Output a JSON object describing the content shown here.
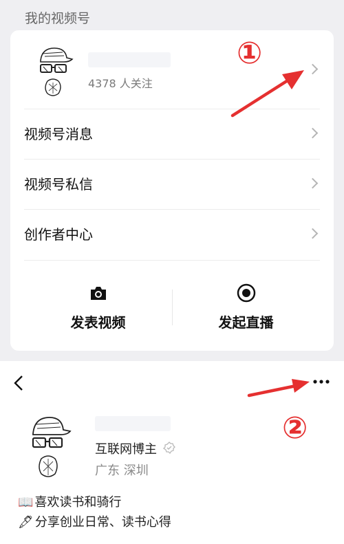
{
  "section": {
    "title": "我的视频号"
  },
  "profile": {
    "followers": "4378 人关注"
  },
  "menu": [
    {
      "label": "视频号消息"
    },
    {
      "label": "视频号私信"
    },
    {
      "label": "创作者中心"
    }
  ],
  "actions": {
    "post_video": "发表视频",
    "start_live": "发起直播"
  },
  "annotations": {
    "marker1": "①",
    "marker2": "②",
    "color": "#e53030"
  },
  "channel": {
    "title": "互联网博主",
    "location": "广东 深圳",
    "bio1_icon": "📖",
    "bio1": "喜欢读书和骑行",
    "bio2_icon": "🖋",
    "bio2": "分享创业日常、读书心得"
  },
  "icons": [
    "camera-icon",
    "record-icon",
    "chevron-right-icon",
    "back-arrow-icon",
    "more-icon",
    "verified-icon",
    "book-icon",
    "pen-icon"
  ]
}
